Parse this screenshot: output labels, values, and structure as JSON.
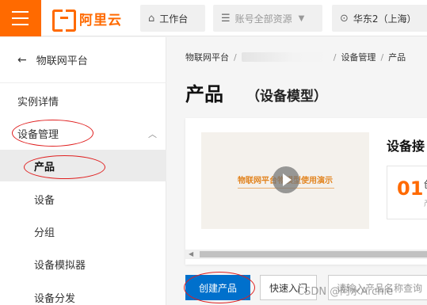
{
  "header": {
    "logo_text": "阿里云",
    "workbench": {
      "icon": "home-icon",
      "label": "工作台"
    },
    "resources": {
      "icon": "resource-group-icon",
      "label": "账号全部资源"
    },
    "region": {
      "icon": "location-icon",
      "label": "华东2（上海）"
    },
    "brand_color": "#ff6a00"
  },
  "sidebar": {
    "back_label": "物联网平台",
    "items": [
      {
        "label": "实例详情"
      },
      {
        "label": "设备管理"
      },
      {
        "label": "产品"
      },
      {
        "label": "设备"
      },
      {
        "label": "分组"
      },
      {
        "label": "设备模拟器"
      },
      {
        "label": "设备分发"
      }
    ]
  },
  "main": {
    "breadcrumb": [
      "物联网平台",
      "设备管理",
      "产品"
    ],
    "title": "产品",
    "subtitle": "（设备模型）",
    "video_caption": "物联网平台物模型使用演示",
    "right_title": "设备接",
    "step_number": "01",
    "step_text": "创",
    "step_sub": "产",
    "create_button": "创建产品",
    "quick_start_button": "快速入门",
    "search_placeholder": "请输入产品名称查询",
    "primary_color": "#0070cc"
  },
  "watermark": "CSDN @阿水Archie"
}
